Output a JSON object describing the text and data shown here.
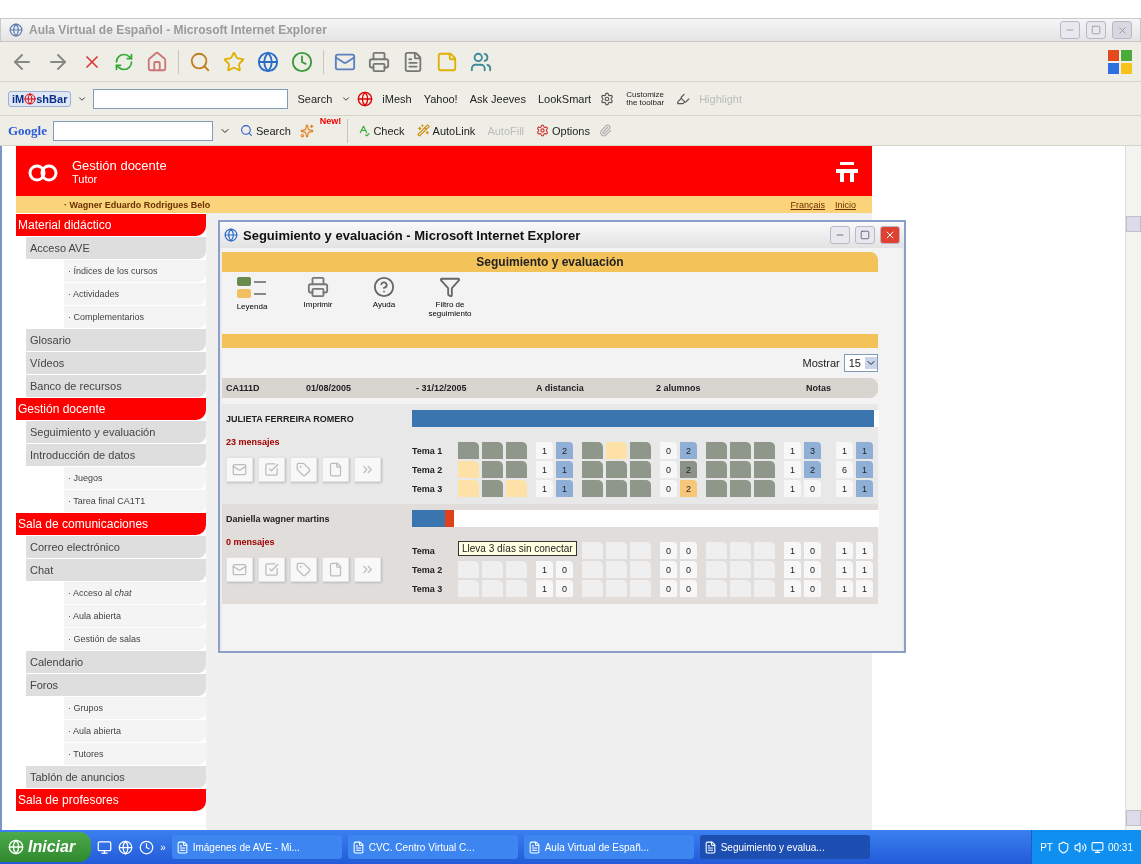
{
  "browser": {
    "title": "Aula Virtual de Español - Microsoft Internet Explorer",
    "imesh_bar": {
      "logo_start": "iM",
      "logo_end": "shBar",
      "search": "Search",
      "links": [
        "iMesh",
        "Yahoo!",
        "Ask Jeeves",
        "LookSmart"
      ],
      "customize": "Customize the toolbar",
      "highlight": "Highlight"
    },
    "google_bar": {
      "logo": "Google",
      "search": "Search",
      "new_badge": "New!",
      "check": "Check",
      "autolink": "AutoLink",
      "autofill": "AutoFill",
      "options": "Options"
    }
  },
  "page": {
    "header": {
      "title": "Gestión docente",
      "subtitle": "Tutor"
    },
    "user": "· Wagner Eduardo Rodrigues Belo",
    "links": [
      "Français",
      "Inicio"
    ],
    "sidebar": [
      {
        "title": "Material didáctico",
        "items": [
          {
            "label": "Acceso AVE",
            "children": [
              {
                "label": "· Índices de los cursos"
              },
              {
                "label": "· Actividades"
              },
              {
                "label": "· Complementarios"
              }
            ]
          },
          {
            "label": "Glosario"
          },
          {
            "label": "Vídeos"
          },
          {
            "label": "Banco de recursos"
          }
        ]
      },
      {
        "title": "Gestión docente",
        "items": [
          {
            "label": "Seguimiento y evaluación"
          },
          {
            "label": "Introducción de datos",
            "children": [
              {
                "label": "· Juegos"
              },
              {
                "label": "· Tarea final CA1T1"
              }
            ]
          }
        ]
      },
      {
        "title": "Sala de comunicaciones",
        "items": [
          {
            "label": "Correo electrónico"
          },
          {
            "label": "Chat",
            "children": [
              {
                "label": "· Acceso al *chat*"
              },
              {
                "label": "· Aula abierta"
              },
              {
                "label": "· Gestión de salas"
              }
            ]
          },
          {
            "label": "Calendario"
          },
          {
            "label": "Foros",
            "children": [
              {
                "label": "· Grupos"
              },
              {
                "label": "· Aula abierta"
              },
              {
                "label": "· Tutores"
              }
            ]
          },
          {
            "label": "Tablón de anuncios"
          }
        ]
      },
      {
        "title": "Sala de profesores"
      }
    ]
  },
  "popup": {
    "title": "Seguimiento y evaluación - Microsoft Internet Explorer",
    "heading": "Seguimiento y evaluación",
    "tools": [
      {
        "label": "Leyenda",
        "kind": "legend"
      },
      {
        "label": "Imprimir",
        "kind": "print"
      },
      {
        "label": "Ayuda",
        "kind": "help"
      },
      {
        "label": "Filtro de seguimiento",
        "kind": "filter"
      }
    ],
    "show_label": "Mostrar",
    "show_value": "15",
    "course": [
      "CA111D",
      "01/08/2005",
      "- 31/12/2005",
      "A distancia",
      "2 alumnos",
      "Notas"
    ],
    "tooltip": "Lleva 3 días sin conectar",
    "students": [
      {
        "name": "JULIETA FERREIRA ROMERO",
        "messages": "23 mensajes",
        "progress": [
          {
            "level": 0.99,
            "color": "#3a75b0"
          }
        ],
        "topics": [
          {
            "label": "Tema 1",
            "groups": [
              {
                "blocks": [
                  {
                    "kind": "done"
                  },
                  {
                    "kind": "done"
                  },
                  {
                    "kind": "done"
                  }
                ],
                "count": "1",
                "badge": {
                  "text": "2",
                  "kind": "blue"
                }
              },
              {
                "blocks": [
                  {
                    "kind": "done"
                  },
                  {
                    "kind": "pending"
                  },
                  {
                    "kind": "done"
                  }
                ],
                "count": "0",
                "badge": {
                  "text": "2",
                  "kind": "blue"
                }
              },
              {
                "blocks": [
                  {
                    "kind": "done"
                  },
                  {
                    "kind": "done"
                  },
                  {
                    "kind": "done"
                  }
                ],
                "count": "1",
                "badge": {
                  "text": "3",
                  "kind": "blue"
                }
              },
              {
                "count": "1",
                "badge": {
                  "text": "1",
                  "kind": "blue"
                }
              }
            ]
          },
          {
            "label": "Tema 2",
            "groups": [
              {
                "blocks": [
                  {
                    "kind": "pending"
                  },
                  {
                    "kind": "done"
                  },
                  {
                    "kind": "done"
                  }
                ],
                "count": "1",
                "badge": {
                  "text": "1",
                  "kind": "blue"
                }
              },
              {
                "blocks": [
                  {
                    "kind": "done"
                  },
                  {
                    "kind": "done"
                  },
                  {
                    "kind": "done"
                  }
                ],
                "count": "0",
                "badge": {
                  "text": "2",
                  "kind": "dark"
                }
              },
              {
                "blocks": [
                  {
                    "kind": "done"
                  },
                  {
                    "kind": "done"
                  },
                  {
                    "kind": "done"
                  }
                ],
                "count": "1",
                "badge": {
                  "text": "2",
                  "kind": "blue"
                }
              },
              {
                "count": "6",
                "badge": {
                  "text": "1",
                  "kind": "blue"
                }
              }
            ]
          },
          {
            "label": "Tema 3",
            "groups": [
              {
                "blocks": [
                  {
                    "kind": "pending"
                  },
                  {
                    "kind": "done"
                  },
                  {
                    "kind": "pending"
                  }
                ],
                "count": "1",
                "badge": {
                  "text": "1",
                  "kind": "blue"
                }
              },
              {
                "blocks": [
                  {
                    "kind": "done"
                  },
                  {
                    "kind": "done"
                  },
                  {
                    "kind": "done"
                  }
                ],
                "count": "0",
                "badge": {
                  "text": "2",
                  "kind": "orange"
                }
              },
              {
                "blocks": [
                  {
                    "kind": "done"
                  },
                  {
                    "kind": "done"
                  },
                  {
                    "kind": "done"
                  }
                ],
                "count": "1",
                "badge": {
                  "text": "0",
                  "kind": "plain"
                }
              },
              {
                "count": "1",
                "badge": {
                  "text": "1",
                  "kind": "blue"
                }
              }
            ]
          }
        ]
      },
      {
        "name": "Daniella wagner martins",
        "messages": "0 mensajes",
        "progress": [
          {
            "level": 0.07,
            "color": "#3a75b0"
          },
          {
            "level": 0.02,
            "color": "#e0401c"
          }
        ],
        "topics": [
          {
            "label": "Tema",
            "groups": [
              {
                "blocks": [
                  {
                    "kind": "empty"
                  },
                  {
                    "kind": "empty"
                  },
                  {
                    "kind": "empty"
                  }
                ],
                "count": "0",
                "badge": {
                  "text": "0",
                  "kind": "plain"
                }
              },
              {
                "blocks": [
                  {
                    "kind": "empty"
                  },
                  {
                    "kind": "empty"
                  },
                  {
                    "kind": "empty"
                  }
                ],
                "count": "1",
                "badge": {
                  "text": "0",
                  "kind": "plain"
                }
              },
              {
                "count": "1",
                "badge": {
                  "text": "1",
                  "kind": "plain"
                }
              }
            ]
          },
          {
            "label": "Tema 2",
            "groups": [
              {
                "blocks": [
                  {
                    "kind": "empty"
                  },
                  {
                    "kind": "empty"
                  },
                  {
                    "kind": "empty"
                  }
                ],
                "count": "1",
                "badge": {
                  "text": "0",
                  "kind": "plain"
                }
              },
              {
                "blocks": [
                  {
                    "kind": "empty"
                  },
                  {
                    "kind": "empty"
                  },
                  {
                    "kind": "empty"
                  }
                ],
                "count": "0",
                "badge": {
                  "text": "0",
                  "kind": "plain"
                }
              },
              {
                "blocks": [
                  {
                    "kind": "empty"
                  },
                  {
                    "kind": "empty"
                  },
                  {
                    "kind": "empty"
                  }
                ],
                "count": "1",
                "badge": {
                  "text": "0",
                  "kind": "plain"
                }
              },
              {
                "count": "1",
                "badge": {
                  "text": "1",
                  "kind": "plain"
                }
              }
            ]
          },
          {
            "label": "Tema 3",
            "groups": [
              {
                "blocks": [
                  {
                    "kind": "empty"
                  },
                  {
                    "kind": "empty"
                  },
                  {
                    "kind": "empty"
                  }
                ],
                "count": "1",
                "badge": {
                  "text": "0",
                  "kind": "plain"
                }
              },
              {
                "blocks": [
                  {
                    "kind": "empty"
                  },
                  {
                    "kind": "empty"
                  },
                  {
                    "kind": "empty"
                  }
                ],
                "count": "0",
                "badge": {
                  "text": "0",
                  "kind": "plain"
                }
              },
              {
                "blocks": [
                  {
                    "kind": "empty"
                  },
                  {
                    "kind": "empty"
                  },
                  {
                    "kind": "empty"
                  }
                ],
                "count": "1",
                "badge": {
                  "text": "0",
                  "kind": "plain"
                }
              },
              {
                "count": "1",
                "badge": {
                  "text": "1",
                  "kind": "plain"
                }
              }
            ]
          }
        ]
      }
    ]
  },
  "taskbar": {
    "start": "Iniciar",
    "more": "»",
    "tasks": [
      {
        "label": "Imágenes de AVE - Mi...",
        "selected": false
      },
      {
        "label": "CVC. Centro Virtual C...",
        "selected": false
      },
      {
        "label": "Aula Virtual de Españ...",
        "selected": false
      },
      {
        "label": "Seguimiento y evalua...",
        "selected": true
      }
    ],
    "language": "PT",
    "clock": "00:31"
  }
}
